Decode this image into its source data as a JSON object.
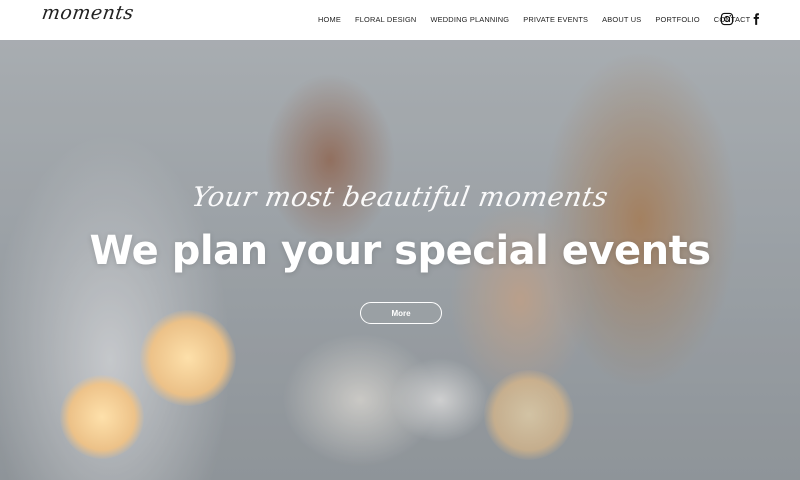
{
  "header": {
    "logo_text": "moments",
    "nav": [
      {
        "label": "HOME"
      },
      {
        "label": "FLORAL DESIGN"
      },
      {
        "label": "WEDDING PLANNING"
      },
      {
        "label": "PRIVATE EVENTS"
      },
      {
        "label": "ABOUT US"
      },
      {
        "label": "PORTFOLIO"
      },
      {
        "label": "CONTACT"
      }
    ],
    "social_icons": [
      "instagram-icon",
      "facebook-icon"
    ]
  },
  "hero": {
    "tagline": "Your most beautiful moments",
    "headline": "We plan your special events",
    "cta_label": "More"
  }
}
